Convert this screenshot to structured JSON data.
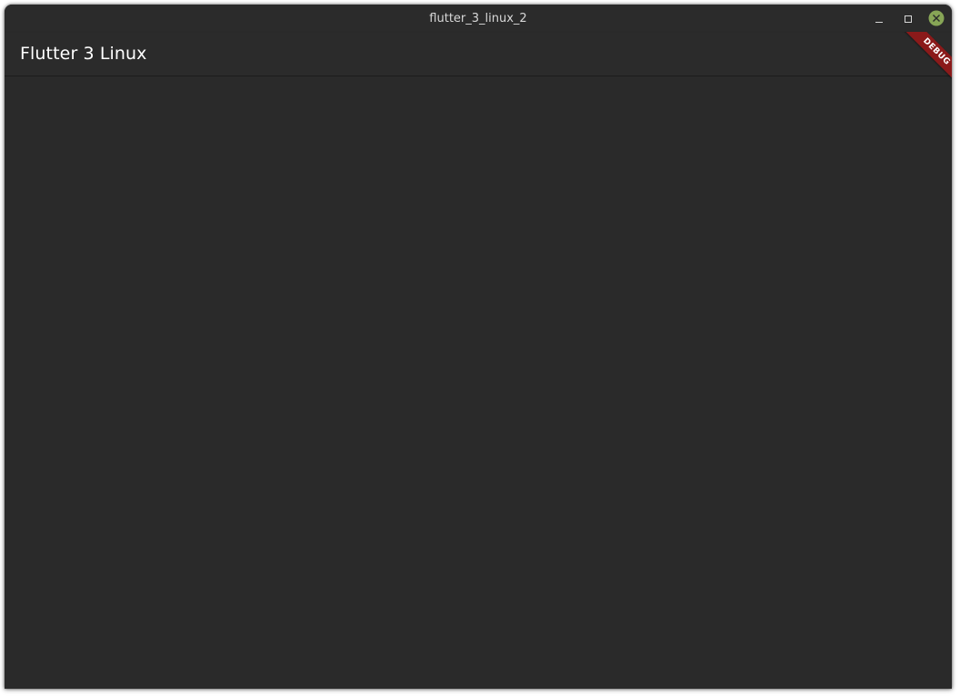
{
  "window": {
    "title": "flutter_3_linux_2",
    "controls": {
      "minimize_icon": "minimize-icon",
      "maximize_icon": "maximize-icon",
      "close_icon": "close-icon",
      "close_color": "#87a556"
    }
  },
  "appbar": {
    "title": "Flutter 3 Linux"
  },
  "debug_banner": {
    "label": "DEBUG",
    "color": "#8b1a1a"
  },
  "colors": {
    "background": "#2a2a2a",
    "titlebar": "#2b2b2b",
    "title_text": "#ffffff"
  }
}
